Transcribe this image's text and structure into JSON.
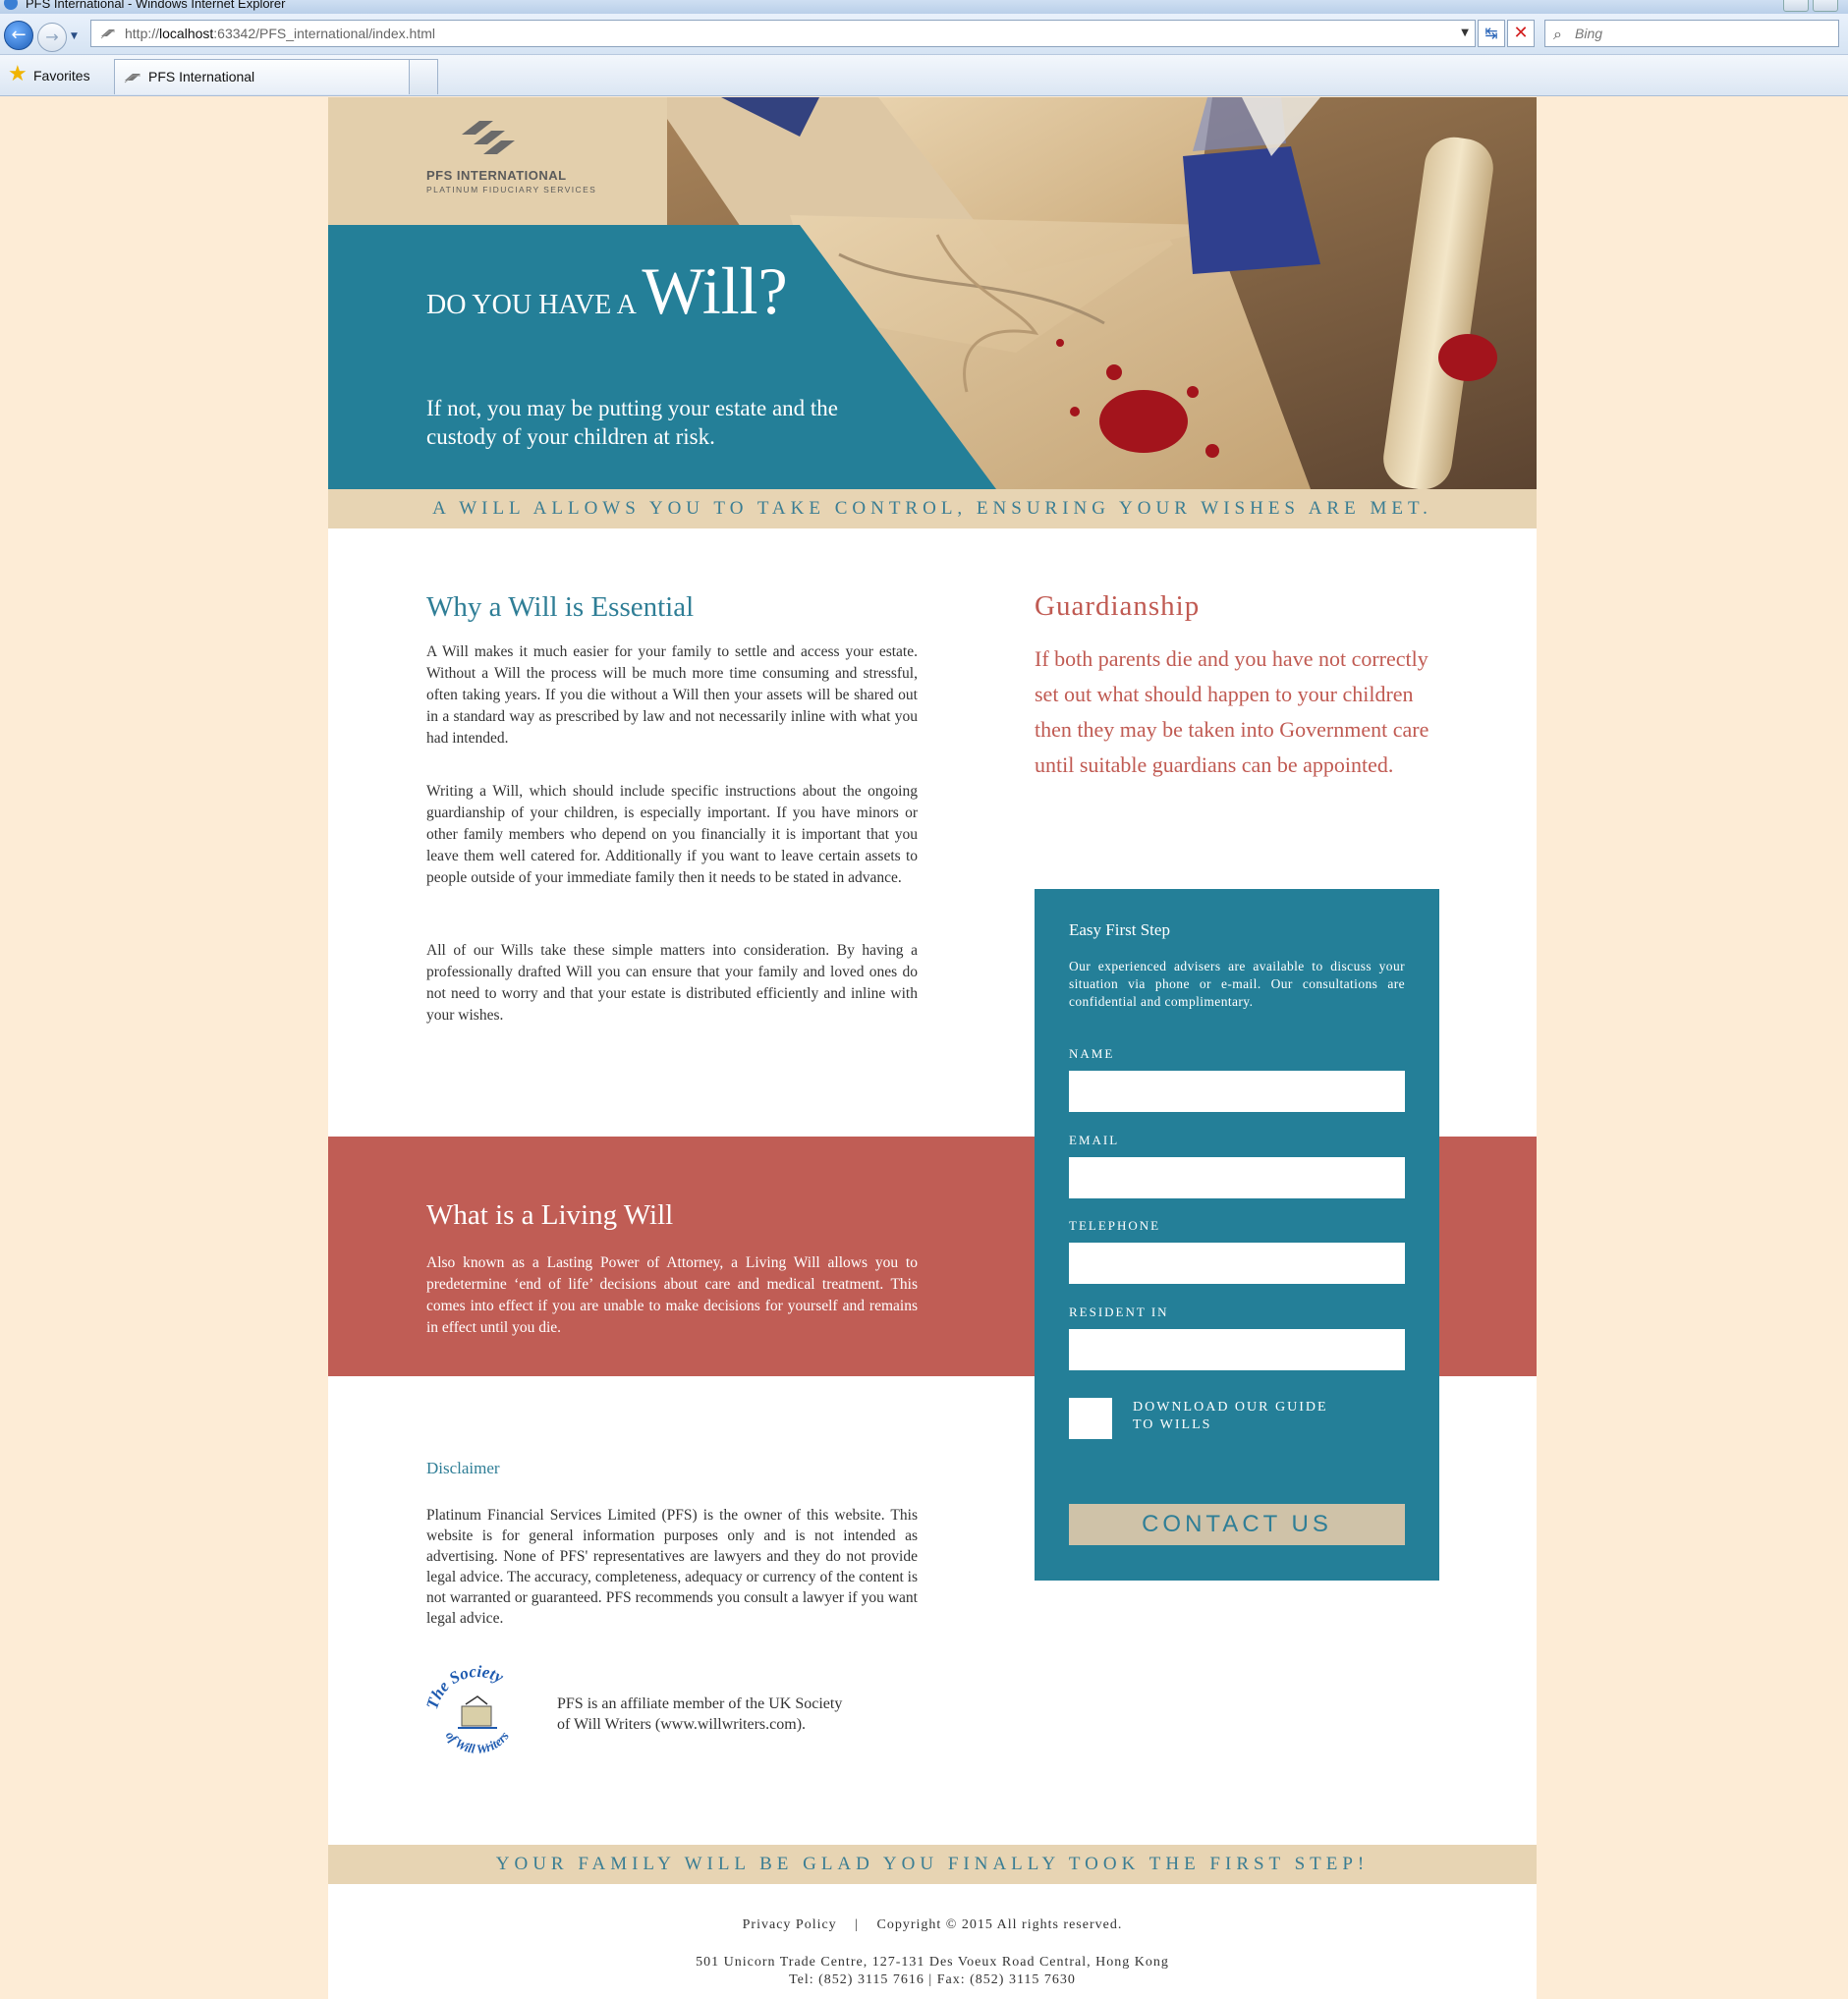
{
  "browser": {
    "window_title": "PFS International - Windows Internet Explorer",
    "address_url_prefix": "http://",
    "address_host": "localhost",
    "address_rest": ":63342/PFS_international/index.html",
    "search_placeholder": "Bing",
    "favorites_label": "Favorites",
    "tab_label": "PFS International"
  },
  "logo": {
    "name": "PFS INTERNATIONAL",
    "tagline": "PLATINUM FIDUCIARY SERVICES"
  },
  "hero": {
    "heading_small": "DO YOU HAVE A",
    "heading_big": "Will?",
    "subheading": "If not, you may be putting your estate and the custody of your children at risk."
  },
  "band_top": "A WILL ALLOWS YOU TO TAKE CONTROL, ENSURING YOUR WISHES ARE MET.",
  "why": {
    "title": "Why a Will is Essential",
    "paragraphs": [
      "A Will makes it much easier for your family to settle and access your estate. Without a Will the process will be much more time consuming and stressful, often taking years. If you die without a Will then your assets will be shared out in a standard way as prescribed by law and not necessarily inline with what you had intended.",
      "Writing a Will, which should include specific instructions about the ongoing guardianship of your children, is especially important. If you have minors or other family members who depend on you financially it is important that you leave them well catered for. Additionally if you want to leave certain assets to people outside of your immediate family then it needs to be stated in advance.",
      "All of our Wills take these simple matters into consideration. By having a professionally drafted Will you can ensure that your family and loved ones do not need to worry and that your estate is distributed efficiently and inline with your wishes."
    ]
  },
  "guardianship": {
    "title": "Guardianship",
    "body": "If both parents die and you have not correctly set out what should happen to your children then they may be taken into Government care until suitable guardians can be appointed."
  },
  "living_will": {
    "title": "What is a Living Will",
    "body": "Also known as a Lasting Power of Attorney, a Living Will allows you to predetermine ‘end of life’ decisions about care and medical treatment. This comes into effect if you are unable to make decisions for yourself and remains in effect until you die."
  },
  "disclaimer": {
    "title": "Disclaimer",
    "body": "Platinum Financial Services Limited (PFS) is the owner of this website. This website is for general information purposes only and is not intended as advertising. None of PFS' representatives are lawyers and they do not provide legal advice. The accuracy, completeness, adequacy or currency of the content is not warranted or guaranteed. PFS recommends you consult a lawyer if you want legal advice.",
    "affiliate": "PFS is an affiliate member of the UK Society of Will Writers (www.willwriters.com).",
    "society_logo_text": "The Society of Will Writers"
  },
  "form": {
    "title": "Easy First Step",
    "intro": "Our experienced advisers are available to discuss your situation via phone or e-mail. Our consultations are confidential and complimentary.",
    "labels": {
      "name": "NAME",
      "email": "EMAIL",
      "telephone": "TELEPHONE",
      "resident": "RESIDENT IN"
    },
    "values": {
      "name": "",
      "email": "",
      "telephone": "",
      "resident": ""
    },
    "checkbox_label": "DOWNLOAD OUR GUIDE TO WILLS",
    "checkbox_checked": false,
    "submit_label": "CONTACT US"
  },
  "band_bottom": "YOUR FAMILY WILL BE GLAD YOU FINALLY TOOK THE FIRST STEP!",
  "footer": {
    "privacy_label": "Privacy Policy",
    "separator": "|",
    "copyright": "Copyright © 2015 All rights reserved.",
    "address": "501 Unicorn Trade Centre, 127-131 Des Voeux Road Central, Hong Kong",
    "contact": "Tel: (852) 3115 7616 | Fax: (852) 3115 7630"
  },
  "colors": {
    "teal": "#247f98",
    "red": "#c05d55",
    "sand": "#e7d4b3",
    "page_bg": "#fdecd6"
  }
}
